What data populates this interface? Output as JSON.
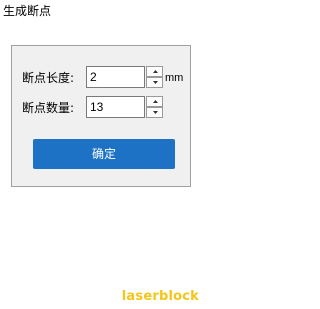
{
  "window": {
    "title": "生成断点"
  },
  "form": {
    "length": {
      "label": "断点长度:",
      "value": "2",
      "unit": "mm"
    },
    "count": {
      "label": "断点数量:",
      "value": "13"
    },
    "confirm_label": "确定"
  },
  "watermark": {
    "text": "laserblock"
  },
  "icons": {
    "spin_up": "triangle-up-icon",
    "spin_down": "triangle-down-icon"
  },
  "colors": {
    "button": "#1e72c6",
    "watermark": "#f5c518"
  }
}
